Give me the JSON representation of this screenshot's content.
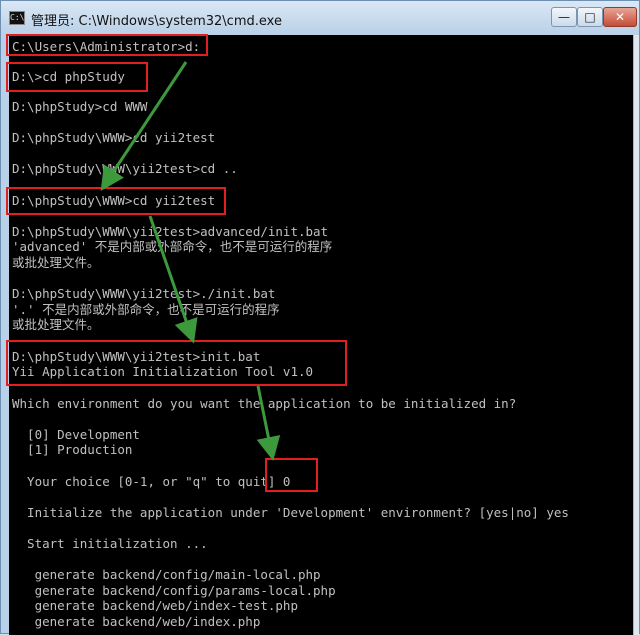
{
  "window": {
    "icon_text": "C:\\",
    "title": "管理员: C:\\Windows\\system32\\cmd.exe",
    "buttons": {
      "minimize": "—",
      "maximize": "□",
      "close": "✕"
    }
  },
  "console": {
    "lines": [
      "C:\\Users\\Administrator>d:",
      "D:\\>cd phpStudy",
      "D:\\phpStudy>cd WWW",
      "D:\\phpStudy\\WWW>cd yii2test",
      "D:\\phpStudy\\WWW\\yii2test>cd ..",
      "D:\\phpStudy\\WWW>cd yii2test",
      "D:\\phpStudy\\WWW\\yii2test>advanced/init.bat",
      "'advanced' 不是内部或外部命令，也不是可运行的程序",
      "或批处理文件。",
      "D:\\phpStudy\\WWW\\yii2test>./init.bat",
      "'.' 不是内部或外部命令，也不是可运行的程序",
      "或批处理文件。",
      "D:\\phpStudy\\WWW\\yii2test>init.bat",
      "Yii Application Initialization Tool v1.0",
      "Which environment do you want the application to be initialized in?",
      "  [0] Development",
      "  [1] Production",
      "  Your choice [0-1, or \"q\" to quit] 0",
      "  Initialize the application under 'Development' environment? [yes|no] yes",
      "  Start initialization ...",
      "   generate backend/config/main-local.php",
      "   generate backend/config/params-local.php",
      "   generate backend/web/index-test.php",
      "   generate backend/web/index.php"
    ]
  },
  "colors": {
    "console_bg": "#000000",
    "console_text": "#c0c0c0",
    "highlight": "#e02020",
    "arrow": "#3c9a3c"
  }
}
